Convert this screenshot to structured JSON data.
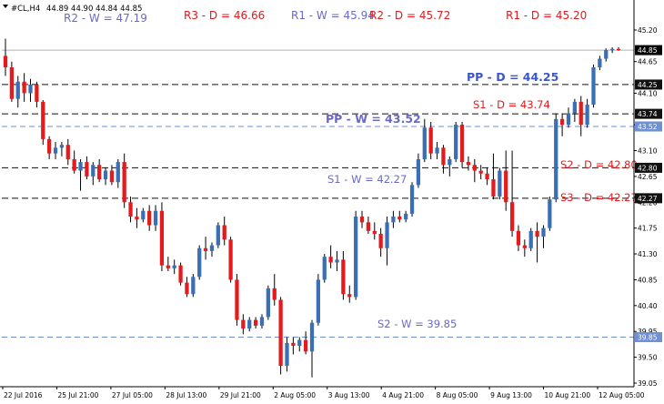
{
  "header": {
    "symbol": "#CL,H4",
    "ohlc": "44.89 44.90 44.84 44.85"
  },
  "colors": {
    "bull": "#3a6fb5",
    "bear": "#e41a1c",
    "wick": "#000000",
    "dashed_level": "#111111",
    "weekly_level": "#6f8fd6",
    "label_red": "#e41a1c",
    "label_blue": "#6a6ac4",
    "pp_label": "#3b57c8",
    "axis_tag_weekly": "#6f8fd6",
    "axis_tag_dark": "#111111",
    "current_price_tag": "#000000"
  },
  "chart_data": {
    "type": "candlestick",
    "y_axis": {
      "ticks": [
        45.2,
        44.65,
        44.1,
        43.55,
        43.1,
        42.65,
        42.2,
        41.75,
        41.3,
        40.85,
        40.4,
        39.95,
        39.5,
        39.05
      ],
      "ylim": [
        39.0,
        45.25
      ]
    },
    "x_axis": {
      "tick_labels": [
        "22 Jul 2016",
        "25 Jul 21:00",
        "27 Jul 05:00",
        "28 Jul 13:00",
        "29 Jul 21:00",
        "2 Aug 05:00",
        "3 Aug 13:00",
        "4 Aug 21:00",
        "8 Aug 05:00",
        "9 Aug 13:00",
        "10 Aug 21:00",
        "12 Aug 05:00"
      ]
    },
    "current_price": 44.85,
    "levels": [
      {
        "label": "R2 - W = 47.19",
        "value": 47.19,
        "style": "weekly-text",
        "color": "label_blue"
      },
      {
        "label": "R3 - D = 46.66",
        "value": 46.66,
        "style": "text",
        "color": "label_red"
      },
      {
        "label": "R1 - W = 45.94",
        "value": 45.94,
        "style": "weekly-text",
        "color": "label_blue"
      },
      {
        "label": "R2 - D = 45.72",
        "value": 45.72,
        "style": "text",
        "color": "label_red"
      },
      {
        "label": "R1 - D = 45.20",
        "value": 45.2,
        "style": "text",
        "color": "label_red"
      },
      {
        "label": "PP - D = 44.25",
        "value": 44.25,
        "style": "daily",
        "axis_tag": "44.25"
      },
      {
        "label": "",
        "value": 43.74,
        "style": "daily",
        "axis_tag": "43.74"
      },
      {
        "label": "S1 - D = 43.74",
        "value": 43.74,
        "style": "label-only",
        "color": "label_red"
      },
      {
        "label": "PP - W = 43.52",
        "value": 43.52,
        "style": "weekly",
        "axis_tag": "43.52"
      },
      {
        "label": "S2 - D = 42.80",
        "value": 42.8,
        "style": "daily",
        "axis_tag": "42.80"
      },
      {
        "label": "S1 - W = 42.27",
        "value": 42.27,
        "style": "weekly-text",
        "color": "label_blue"
      },
      {
        "label": "S3 - D = 42.27",
        "value": 42.27,
        "style": "daily",
        "axis_tag": "42.27"
      },
      {
        "label": "S2 - W = 39.85",
        "value": 39.85,
        "style": "weekly",
        "axis_tag": "39.85"
      }
    ],
    "candles": [
      {
        "o": 44.75,
        "h": 45.05,
        "l": 44.4,
        "c": 44.55
      },
      {
        "o": 44.55,
        "h": 44.65,
        "l": 43.95,
        "c": 44.0
      },
      {
        "o": 44.0,
        "h": 44.4,
        "l": 43.85,
        "c": 44.3
      },
      {
        "o": 44.3,
        "h": 44.45,
        "l": 43.95,
        "c": 44.1
      },
      {
        "o": 44.1,
        "h": 44.35,
        "l": 43.95,
        "c": 44.25
      },
      {
        "o": 44.25,
        "h": 44.3,
        "l": 43.85,
        "c": 43.95
      },
      {
        "o": 43.95,
        "h": 43.98,
        "l": 43.2,
        "c": 43.3
      },
      {
        "o": 43.3,
        "h": 43.35,
        "l": 42.95,
        "c": 43.05
      },
      {
        "o": 43.05,
        "h": 43.25,
        "l": 42.95,
        "c": 43.15
      },
      {
        "o": 43.15,
        "h": 43.25,
        "l": 43.0,
        "c": 43.2
      },
      {
        "o": 43.2,
        "h": 43.3,
        "l": 42.85,
        "c": 42.95
      },
      {
        "o": 42.95,
        "h": 43.1,
        "l": 42.7,
        "c": 42.75
      },
      {
        "o": 42.75,
        "h": 42.95,
        "l": 42.4,
        "c": 42.9
      },
      {
        "o": 42.9,
        "h": 43.0,
        "l": 42.6,
        "c": 42.65
      },
      {
        "o": 42.65,
        "h": 42.9,
        "l": 42.5,
        "c": 42.85
      },
      {
        "o": 42.85,
        "h": 42.95,
        "l": 42.55,
        "c": 42.6
      },
      {
        "o": 42.6,
        "h": 42.8,
        "l": 42.5,
        "c": 42.75
      },
      {
        "o": 42.75,
        "h": 42.85,
        "l": 42.5,
        "c": 42.55
      },
      {
        "o": 42.55,
        "h": 42.95,
        "l": 42.45,
        "c": 42.9
      },
      {
        "o": 42.9,
        "h": 43.05,
        "l": 42.1,
        "c": 42.2
      },
      {
        "o": 42.2,
        "h": 42.3,
        "l": 41.85,
        "c": 41.95
      },
      {
        "o": 41.95,
        "h": 42.1,
        "l": 41.75,
        "c": 41.9
      },
      {
        "o": 41.9,
        "h": 42.1,
        "l": 41.85,
        "c": 42.05
      },
      {
        "o": 42.05,
        "h": 42.15,
        "l": 41.7,
        "c": 41.8
      },
      {
        "o": 41.8,
        "h": 42.15,
        "l": 41.7,
        "c": 42.05
      },
      {
        "o": 42.05,
        "h": 42.2,
        "l": 41.0,
        "c": 41.1
      },
      {
        "o": 41.1,
        "h": 41.25,
        "l": 41.0,
        "c": 41.05
      },
      {
        "o": 41.05,
        "h": 41.2,
        "l": 40.95,
        "c": 41.1
      },
      {
        "o": 41.1,
        "h": 41.15,
        "l": 40.75,
        "c": 40.8
      },
      {
        "o": 40.8,
        "h": 40.9,
        "l": 40.55,
        "c": 40.6
      },
      {
        "o": 40.6,
        "h": 40.95,
        "l": 40.55,
        "c": 40.9
      },
      {
        "o": 40.9,
        "h": 41.45,
        "l": 40.85,
        "c": 41.4
      },
      {
        "o": 41.4,
        "h": 41.6,
        "l": 41.2,
        "c": 41.35
      },
      {
        "o": 41.35,
        "h": 41.5,
        "l": 41.25,
        "c": 41.45
      },
      {
        "o": 41.45,
        "h": 41.85,
        "l": 41.4,
        "c": 41.8
      },
      {
        "o": 41.8,
        "h": 41.95,
        "l": 41.45,
        "c": 41.55
      },
      {
        "o": 41.55,
        "h": 41.6,
        "l": 40.8,
        "c": 40.85
      },
      {
        "o": 40.85,
        "h": 40.95,
        "l": 40.05,
        "c": 40.15
      },
      {
        "o": 40.15,
        "h": 40.25,
        "l": 39.9,
        "c": 40.0
      },
      {
        "o": 40.0,
        "h": 40.2,
        "l": 39.95,
        "c": 40.15
      },
      {
        "o": 40.15,
        "h": 40.2,
        "l": 40.0,
        "c": 40.05
      },
      {
        "o": 40.05,
        "h": 40.25,
        "l": 40.0,
        "c": 40.2
      },
      {
        "o": 40.2,
        "h": 40.75,
        "l": 40.15,
        "c": 40.7
      },
      {
        "o": 40.7,
        "h": 40.95,
        "l": 40.4,
        "c": 40.5
      },
      {
        "o": 40.5,
        "h": 40.55,
        "l": 39.2,
        "c": 39.35
      },
      {
        "o": 39.35,
        "h": 39.85,
        "l": 39.25,
        "c": 39.75
      },
      {
        "o": 39.75,
        "h": 39.85,
        "l": 39.55,
        "c": 39.7
      },
      {
        "o": 39.7,
        "h": 39.85,
        "l": 39.6,
        "c": 39.8
      },
      {
        "o": 39.8,
        "h": 39.95,
        "l": 39.55,
        "c": 39.6
      },
      {
        "o": 39.6,
        "h": 40.15,
        "l": 39.15,
        "c": 40.1
      },
      {
        "o": 40.1,
        "h": 40.95,
        "l": 40.05,
        "c": 40.85
      },
      {
        "o": 40.85,
        "h": 41.3,
        "l": 40.8,
        "c": 41.25
      },
      {
        "o": 41.25,
        "h": 41.45,
        "l": 41.05,
        "c": 41.15
      },
      {
        "o": 41.15,
        "h": 41.35,
        "l": 41.0,
        "c": 41.2
      },
      {
        "o": 41.2,
        "h": 41.35,
        "l": 40.5,
        "c": 40.6
      },
      {
        "o": 40.6,
        "h": 40.75,
        "l": 40.45,
        "c": 40.55
      },
      {
        "o": 40.55,
        "h": 42.05,
        "l": 40.5,
        "c": 41.95
      },
      {
        "o": 41.95,
        "h": 42.05,
        "l": 41.75,
        "c": 41.85
      },
      {
        "o": 41.85,
        "h": 41.95,
        "l": 41.65,
        "c": 41.7
      },
      {
        "o": 41.7,
        "h": 41.85,
        "l": 41.55,
        "c": 41.65
      },
      {
        "o": 41.65,
        "h": 41.75,
        "l": 41.25,
        "c": 41.4
      },
      {
        "o": 41.4,
        "h": 41.95,
        "l": 41.1,
        "c": 41.85
      },
      {
        "o": 41.85,
        "h": 42.05,
        "l": 41.75,
        "c": 41.95
      },
      {
        "o": 41.95,
        "h": 42.05,
        "l": 41.85,
        "c": 41.9
      },
      {
        "o": 41.9,
        "h": 42.05,
        "l": 41.85,
        "c": 42.0
      },
      {
        "o": 42.0,
        "h": 42.55,
        "l": 41.95,
        "c": 42.5
      },
      {
        "o": 42.5,
        "h": 43.05,
        "l": 42.45,
        "c": 42.95
      },
      {
        "o": 42.95,
        "h": 43.65,
        "l": 42.9,
        "c": 43.5
      },
      {
        "o": 43.5,
        "h": 43.6,
        "l": 42.95,
        "c": 43.05
      },
      {
        "o": 43.05,
        "h": 43.25,
        "l": 42.95,
        "c": 43.15
      },
      {
        "o": 43.15,
        "h": 43.2,
        "l": 42.7,
        "c": 42.85
      },
      {
        "o": 42.85,
        "h": 43.0,
        "l": 42.65,
        "c": 42.95
      },
      {
        "o": 42.95,
        "h": 43.6,
        "l": 42.9,
        "c": 43.55
      },
      {
        "o": 43.55,
        "h": 43.6,
        "l": 42.8,
        "c": 42.9
      },
      {
        "o": 42.9,
        "h": 43.0,
        "l": 42.75,
        "c": 42.85
      },
      {
        "o": 42.85,
        "h": 42.95,
        "l": 42.55,
        "c": 42.75
      },
      {
        "o": 42.75,
        "h": 42.85,
        "l": 42.6,
        "c": 42.7
      },
      {
        "o": 42.7,
        "h": 42.8,
        "l": 42.5,
        "c": 42.6
      },
      {
        "o": 42.6,
        "h": 43.05,
        "l": 42.25,
        "c": 42.3
      },
      {
        "o": 42.3,
        "h": 42.8,
        "l": 42.25,
        "c": 42.75
      },
      {
        "o": 42.75,
        "h": 43.1,
        "l": 42.05,
        "c": 42.2
      },
      {
        "o": 42.2,
        "h": 43.1,
        "l": 41.6,
        "c": 41.7
      },
      {
        "o": 41.7,
        "h": 41.8,
        "l": 41.35,
        "c": 41.45
      },
      {
        "o": 41.45,
        "h": 41.55,
        "l": 41.25,
        "c": 41.4
      },
      {
        "o": 41.4,
        "h": 41.75,
        "l": 41.35,
        "c": 41.7
      },
      {
        "o": 41.7,
        "h": 41.85,
        "l": 41.15,
        "c": 41.6
      },
      {
        "o": 41.6,
        "h": 41.8,
        "l": 41.4,
        "c": 41.75
      },
      {
        "o": 41.75,
        "h": 42.3,
        "l": 41.7,
        "c": 42.25
      },
      {
        "o": 42.25,
        "h": 43.75,
        "l": 42.2,
        "c": 43.65
      },
      {
        "o": 43.65,
        "h": 43.75,
        "l": 43.35,
        "c": 43.55
      },
      {
        "o": 43.55,
        "h": 43.85,
        "l": 43.5,
        "c": 43.75
      },
      {
        "o": 43.75,
        "h": 44.0,
        "l": 43.6,
        "c": 43.95
      },
      {
        "o": 43.95,
        "h": 44.05,
        "l": 43.35,
        "c": 43.55
      },
      {
        "o": 43.55,
        "h": 44.0,
        "l": 43.5,
        "c": 43.9
      },
      {
        "o": 43.9,
        "h": 44.6,
        "l": 43.85,
        "c": 44.55
      },
      {
        "o": 44.55,
        "h": 44.75,
        "l": 44.5,
        "c": 44.7
      },
      {
        "o": 44.7,
        "h": 44.88,
        "l": 44.65,
        "c": 44.85
      },
      {
        "o": 44.85,
        "h": 44.9,
        "l": 44.8,
        "c": 44.87
      },
      {
        "o": 44.87,
        "h": 44.9,
        "l": 44.84,
        "c": 44.85
      }
    ]
  }
}
